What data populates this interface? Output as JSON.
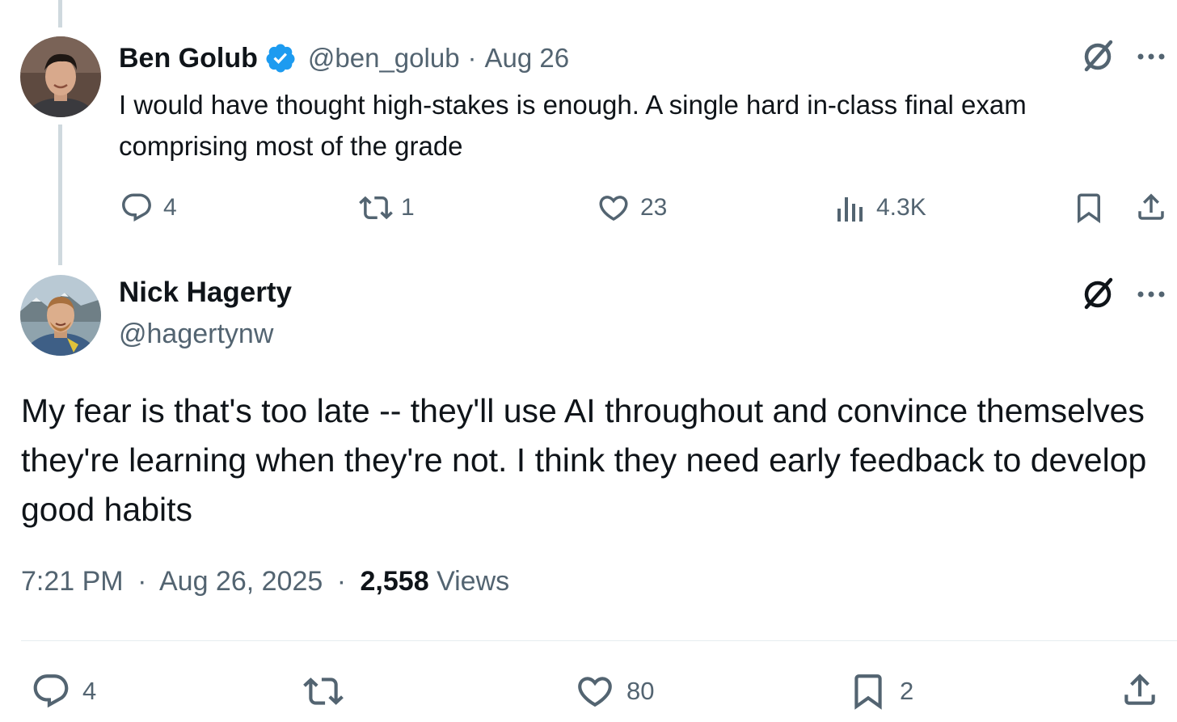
{
  "parent": {
    "author_name": "Ben Golub",
    "handle": "@ben_golub",
    "separator": "·",
    "date": "Aug 26",
    "text": "I would have thought high-stakes is enough. A single hard in-class final exam comprising most of the grade",
    "stats": {
      "replies": "4",
      "reposts": "1",
      "likes": "23",
      "views": "4.3K"
    },
    "verified": true
  },
  "reply": {
    "author_name": "Nick Hagerty",
    "handle": "@hagertynw",
    "text": "My fear is that's too late -- they'll use AI throughout and convince themselves they're learning when they're not. I think they need early feedback to develop good habits",
    "time": "7:21 PM",
    "sep1": "·",
    "date": "Aug 26, 2025",
    "sep2": "·",
    "views_count": "2,558",
    "views_label": "Views",
    "stats": {
      "replies": "4",
      "likes": "80",
      "bookmarks": "2"
    }
  },
  "colors": {
    "text": "#0f1419",
    "muted": "#536471",
    "verified": "#1d9bf0",
    "thread_line": "#cfd9de",
    "divider": "#e6ecf0"
  }
}
